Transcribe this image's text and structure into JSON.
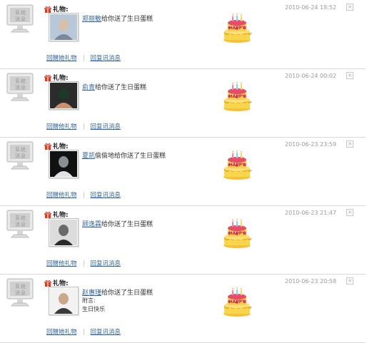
{
  "gift_label": "礼物:",
  "note_label": "附言:",
  "close_glyph": "✕",
  "colors": {
    "link": "#336699",
    "timestamp": "#999999",
    "separator": "#d8d8d8"
  },
  "icons": {
    "gift": "gift-box-icon",
    "system": "system-message-monitor-icon",
    "cake": "birthday-cake-icon"
  },
  "cake_text": "HAPPY",
  "items": [
    {
      "sender": "郑丽敏",
      "message": "给你送了生日蛋糕",
      "timestamp": "2010-06-24 18:52",
      "return_gift": "回赠她礼物",
      "reply": "回复讯消息",
      "note": ""
    },
    {
      "sender": "俞青",
      "message": "给你送了生日蛋糕",
      "timestamp": "2010-06-24 00:02",
      "return_gift": "回赠他礼物",
      "reply": "回复讯消息",
      "note": ""
    },
    {
      "sender": "夏凯",
      "message": "偷偷地给你送了生日蛋糕",
      "timestamp": "2010-06-23 23:59",
      "return_gift": "回赠他礼物",
      "reply": "回复讯消息",
      "note": ""
    },
    {
      "sender": "顾逸霖",
      "message": "给你送了生日蛋糕",
      "timestamp": "2010-06-23 21:47",
      "return_gift": "回赠他礼物",
      "reply": "回复讯消息",
      "note": ""
    },
    {
      "sender": "赵惠瑾",
      "message": "给你送了生日蛋糕",
      "timestamp": "2010-06-23 20:58",
      "return_gift": "回赠她礼物",
      "reply": "回复讯消息",
      "note": "生日快乐"
    }
  ]
}
